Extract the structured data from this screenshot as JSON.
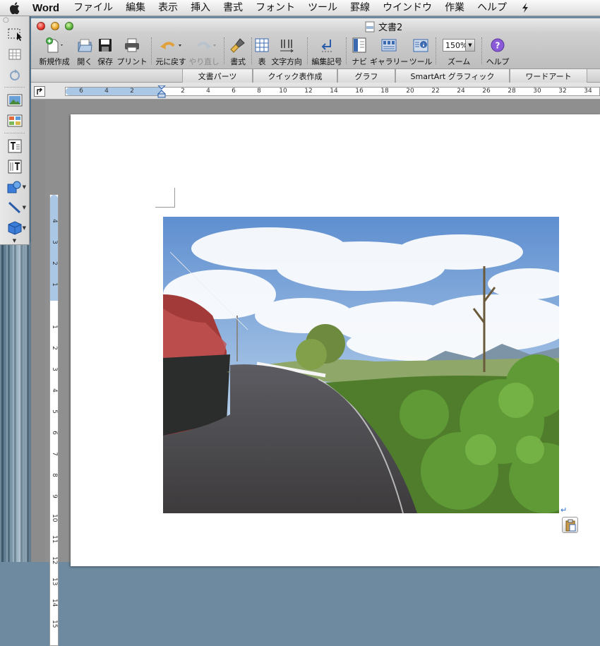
{
  "menubar": {
    "app_name": "Word",
    "items": [
      "ファイル",
      "編集",
      "表示",
      "挿入",
      "書式",
      "フォント",
      "ツール",
      "罫線",
      "ウインドウ",
      "作業",
      "ヘルプ"
    ]
  },
  "window": {
    "title": "文書2"
  },
  "toolbar": {
    "new": "新規作成",
    "open": "開く",
    "save": "保存",
    "print": "プリント",
    "undo": "元に戻す",
    "redo": "やり直し",
    "format": "書式",
    "table": "表",
    "text_direction": "文字方向",
    "edit_marks": "編集記号",
    "navi": "ナビ",
    "gallery": "ギャラリー",
    "tools": "ツール",
    "zoom_label": "ズーム",
    "zoom_value": "150%",
    "help": "ヘルプ"
  },
  "ribbon_tabs": [
    "文書パーツ",
    "クイック表作成",
    "グラフ",
    "SmartArt グラフィック",
    "ワードアート"
  ],
  "ruler": {
    "horizontal_ticks": [
      "6",
      "4",
      "2",
      "2",
      "4",
      "6",
      "8",
      "10",
      "12",
      "14",
      "16",
      "18",
      "20",
      "22",
      "24",
      "26",
      "28",
      "30",
      "32",
      "34"
    ],
    "vertical_ticks": [
      "4",
      "3",
      "2",
      "1",
      "1",
      "2",
      "3",
      "4",
      "5",
      "6",
      "7",
      "8",
      "9",
      "10",
      "11",
      "12",
      "13",
      "14",
      "15"
    ]
  },
  "colors": {
    "ruler_margin": "#aac8e6",
    "page": "#ffffff",
    "workspace": "#8f8f8f"
  }
}
